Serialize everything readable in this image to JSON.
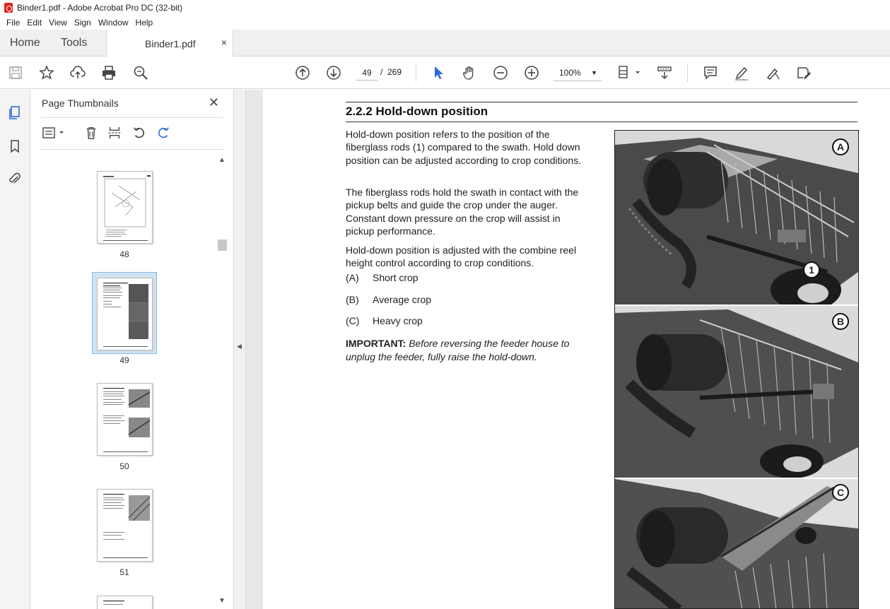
{
  "window": {
    "title": "Binder1.pdf - Adobe Acrobat Pro DC (32-bit)"
  },
  "menu": [
    "File",
    "Edit",
    "View",
    "Sign",
    "Window",
    "Help"
  ],
  "tabs": {
    "home": "Home",
    "tools": "Tools",
    "document": "Binder1.pdf",
    "close": "×"
  },
  "toolbar": {
    "page_current": "49",
    "page_sep": "/",
    "page_total": "269",
    "zoom": "100%"
  },
  "thumbnails": {
    "title": "Page Thumbnails",
    "close": "✕",
    "pages": [
      {
        "label": "48",
        "selected": false
      },
      {
        "label": "49",
        "selected": true
      },
      {
        "label": "50",
        "selected": false
      },
      {
        "label": "51",
        "selected": false
      }
    ]
  },
  "document": {
    "section_title": "2.2.2  Hold-down position",
    "paragraph1": "Hold-down position refers to the position of the fiberglass rods (1) compared to the swath. Hold down position can be adjusted according to crop conditions.",
    "paragraph2": "The fiberglass rods hold the swath in contact with the pickup belts and guide the crop under the auger. Constant down pressure on the crop will assist in pickup performance.",
    "paragraph3": "Hold-down position is adjusted with the combine reel height control according to crop conditions.",
    "items": [
      {
        "key": "(A)",
        "text": "Short crop"
      },
      {
        "key": "(B)",
        "text": "Average crop"
      },
      {
        "key": "(C)",
        "text": "Heavy crop"
      }
    ],
    "important_label": "IMPORTANT:",
    "important_text": "Before reversing the feeder house to unplug the feeder, fully raise the hold-down.",
    "figure_callouts": {
      "a": "A",
      "b": "B",
      "c": "C",
      "one": "1"
    }
  },
  "colors": {
    "accent": "#2d6bd6",
    "title_icon": "#e0211b"
  }
}
